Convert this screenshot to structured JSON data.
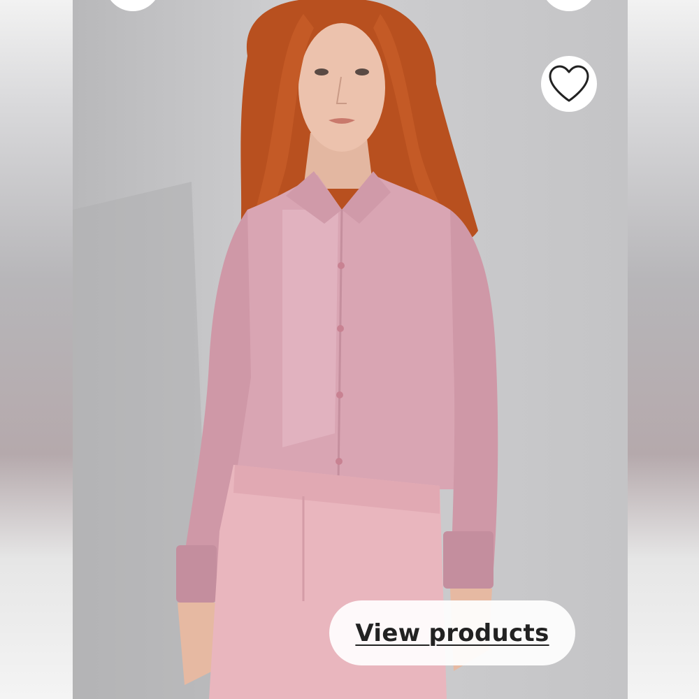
{
  "actions": {
    "view_products_label": "View products"
  },
  "icons": {
    "favorite": "heart-outline-icon",
    "top_left": "overlay-button-icon",
    "top_right": "overlay-button-icon"
  },
  "colors": {
    "background": "#c9c9cb",
    "button_bg": "#ffffff",
    "text": "#222222",
    "shirt": "#d8a4b2",
    "skirt": "#e8b4bc",
    "hair": "#c2552a"
  }
}
